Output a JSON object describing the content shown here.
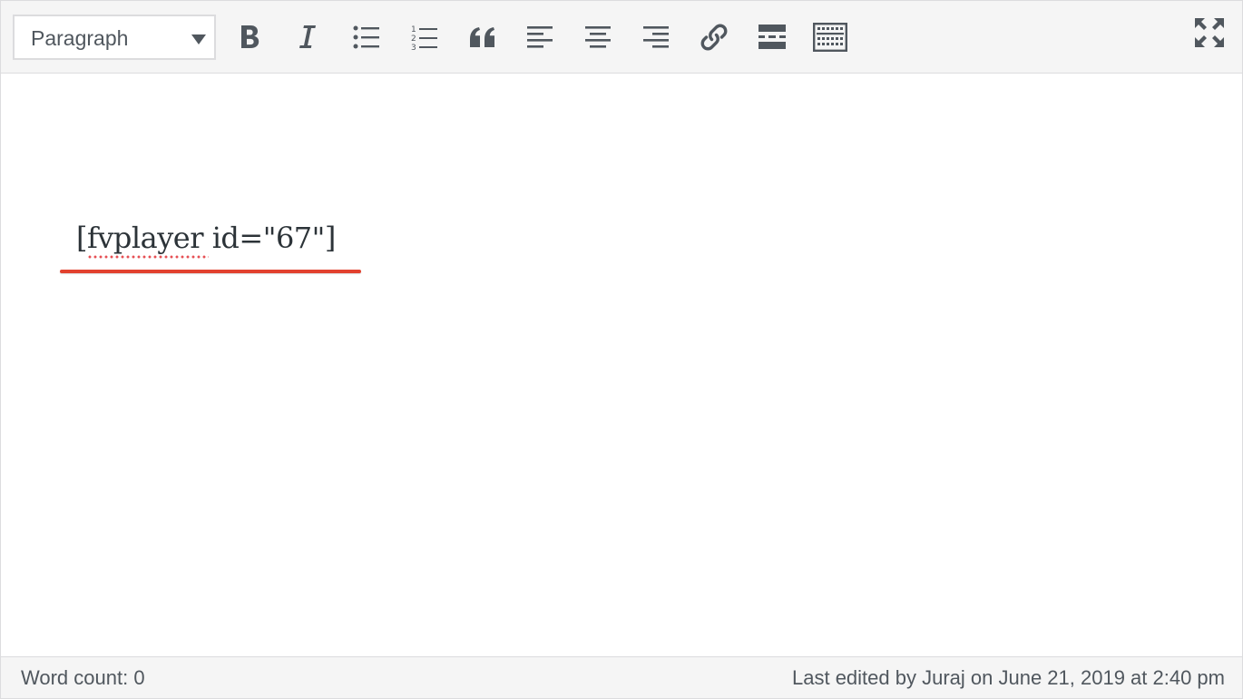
{
  "toolbar": {
    "format_select_value": "Paragraph",
    "buttons": [
      {
        "name": "bold",
        "icon": "bold-icon"
      },
      {
        "name": "italic",
        "icon": "italic-icon"
      },
      {
        "name": "bulleted-list",
        "icon": "bulleted-list-icon"
      },
      {
        "name": "numbered-list",
        "icon": "numbered-list-icon"
      },
      {
        "name": "blockquote",
        "icon": "quote-icon"
      },
      {
        "name": "align-left",
        "icon": "align-left-icon"
      },
      {
        "name": "align-center",
        "icon": "align-center-icon"
      },
      {
        "name": "align-right",
        "icon": "align-right-icon"
      },
      {
        "name": "insert-link",
        "icon": "link-icon"
      },
      {
        "name": "read-more",
        "icon": "read-more-icon"
      },
      {
        "name": "toolbar-toggle",
        "icon": "keyboard-icon"
      },
      {
        "name": "fullscreen",
        "icon": "fullscreen-icon"
      }
    ],
    "icon_color": "#50575e"
  },
  "content": {
    "text": "[fvplayer id=\"67\"]",
    "highlight_color": "#e2412e",
    "spellcheck_color": "#e65054"
  },
  "status": {
    "word_count": "Word count: 0",
    "last_edited": "Last edited by Juraj on June 21, 2019 at 2:40 pm"
  }
}
